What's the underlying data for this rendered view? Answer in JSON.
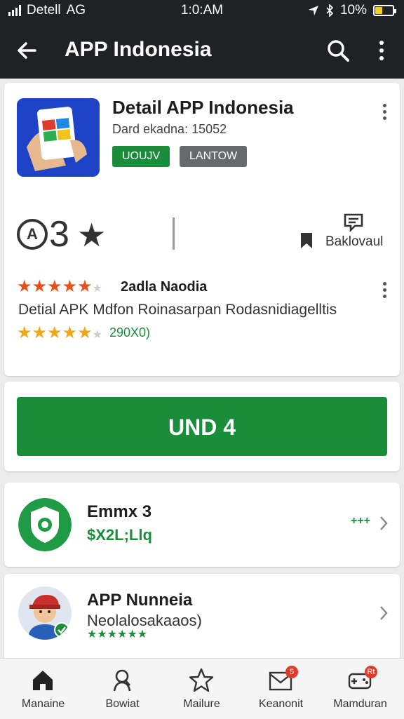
{
  "status_bar": {
    "carrier": "Detell",
    "network": "AG",
    "time": "1:0:AM",
    "battery": "10%"
  },
  "app_bar": {
    "title": "APP Indonesia",
    "icons": [
      "back-arrow-icon",
      "search-icon",
      "more-vert-icon"
    ]
  },
  "app_card": {
    "name": "Detail APP Indonesia",
    "developer": "Dard ekadna: 15052",
    "badges": [
      "UOUJV",
      "LANTOW"
    ],
    "rating_symbol": "A",
    "rating_value": "3",
    "save_label": "Baklovaul",
    "review": {
      "stars_filled": 5,
      "name": "2adla Naodia",
      "text": "Detial APK Mdfon Roinasarpan Rodasnidiagelltis",
      "count": "290X0)",
      "count_stars_filled": 5
    }
  },
  "install_button": {
    "label": "UND 4"
  },
  "list_items": [
    {
      "title": "Emmx 3",
      "subtitle": "$X2L;Llq",
      "trailing": "+++"
    },
    {
      "title": "APP Nunneia",
      "subtitle": "Neolalosakaaos)",
      "rating_stars": 6
    }
  ],
  "bottom_nav": [
    {
      "label": "Manaine",
      "icon": "home-icon"
    },
    {
      "label": "Bowiat",
      "icon": "person-search-icon"
    },
    {
      "label": "Mailure",
      "icon": "star-icon"
    },
    {
      "label": "Keanonit",
      "icon": "mail-icon",
      "badge": "5"
    },
    {
      "label": "Mamduran",
      "icon": "game-controller-icon",
      "badge": "Rt"
    }
  ],
  "colors": {
    "primary_green": "#1a8d3b",
    "top_bar": "#1f2124",
    "star_orange": "#e8501a",
    "star_amber": "#f0a716",
    "badge_red": "#e03a2a"
  }
}
